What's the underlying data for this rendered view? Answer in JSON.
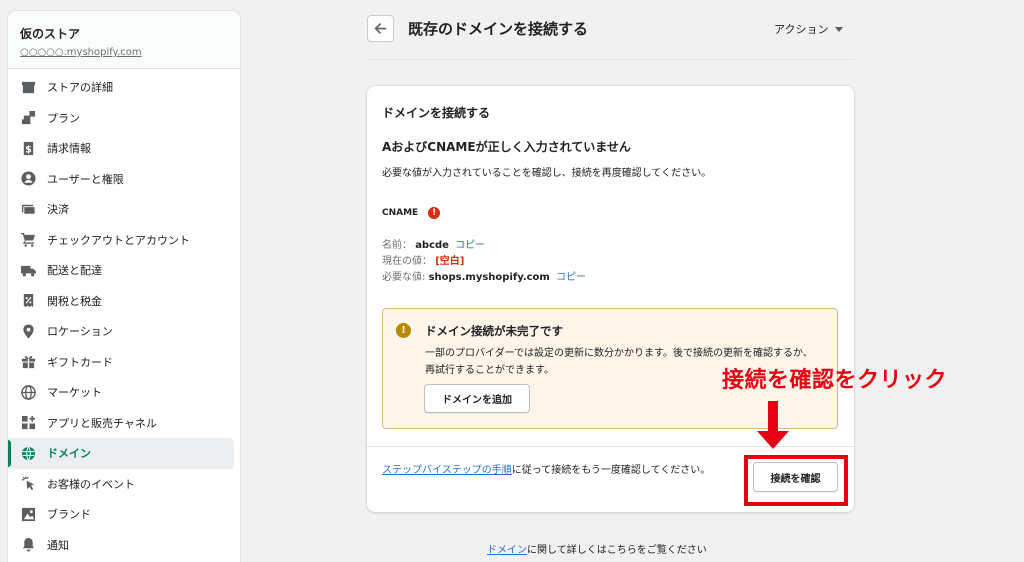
{
  "store": {
    "name": "仮のストア",
    "url": "○○○○○.myshopify.com"
  },
  "sidebar": {
    "items": [
      {
        "label": "ストアの詳細",
        "icon": "store-icon"
      },
      {
        "label": "プラン",
        "icon": "plan-icon"
      },
      {
        "label": "請求情報",
        "icon": "billing-icon"
      },
      {
        "label": "ユーザーと権限",
        "icon": "user-icon"
      },
      {
        "label": "決済",
        "icon": "payment-icon"
      },
      {
        "label": "チェックアウトとアカウント",
        "icon": "cart-icon"
      },
      {
        "label": "配送と配達",
        "icon": "truck-icon"
      },
      {
        "label": "関税と税金",
        "icon": "tax-icon"
      },
      {
        "label": "ロケーション",
        "icon": "location-icon"
      },
      {
        "label": "ギフトカード",
        "icon": "gift-icon"
      },
      {
        "label": "マーケット",
        "icon": "globe-icon"
      },
      {
        "label": "アプリと販売チャネル",
        "icon": "apps-icon"
      },
      {
        "label": "ドメイン",
        "icon": "domain-icon",
        "active": true
      },
      {
        "label": "お客様のイベント",
        "icon": "cursor-icon"
      },
      {
        "label": "ブランド",
        "icon": "brand-icon"
      },
      {
        "label": "通知",
        "icon": "bell-icon"
      }
    ]
  },
  "header": {
    "title": "既存のドメインを接続する",
    "actions_label": "アクション"
  },
  "card": {
    "title": "ドメインを接続する",
    "error_title": "AおよびCNAMEが正しく入力されていません",
    "error_desc": "必要な値が入力されていることを確認し、接続を再度確認してください。",
    "record_type": "CNAME",
    "name_label": "名前：",
    "name_value": "abcde",
    "current_label": "現在の値：",
    "current_value": "[空白]",
    "required_label": "必要な値:",
    "required_value": "shops.myshopify.com",
    "copy_label": "コピー",
    "banner": {
      "title": "ドメイン接続が未完了です",
      "text": "一部のプロバイダーでは設定の更新に数分かかります。後で接続の更新を確認するか、再試行することができます。",
      "button": "ドメインを追加"
    },
    "footer_link": "ステップバイステップの手順",
    "footer_text": "に従って接続をもう一度確認してください。",
    "confirm_button": "接続を確認"
  },
  "annotation": {
    "text": "接続を確認をクリック",
    "color": "#e60012"
  },
  "bottom_help": {
    "link": "ドメイン",
    "text": "に関して詳しくはこちらをご覧ください"
  },
  "colors": {
    "accent": "#008060",
    "link": "#2c6ecb",
    "critical": "#d72c0d",
    "warning": "#b98900",
    "annotation": "#e60012"
  }
}
